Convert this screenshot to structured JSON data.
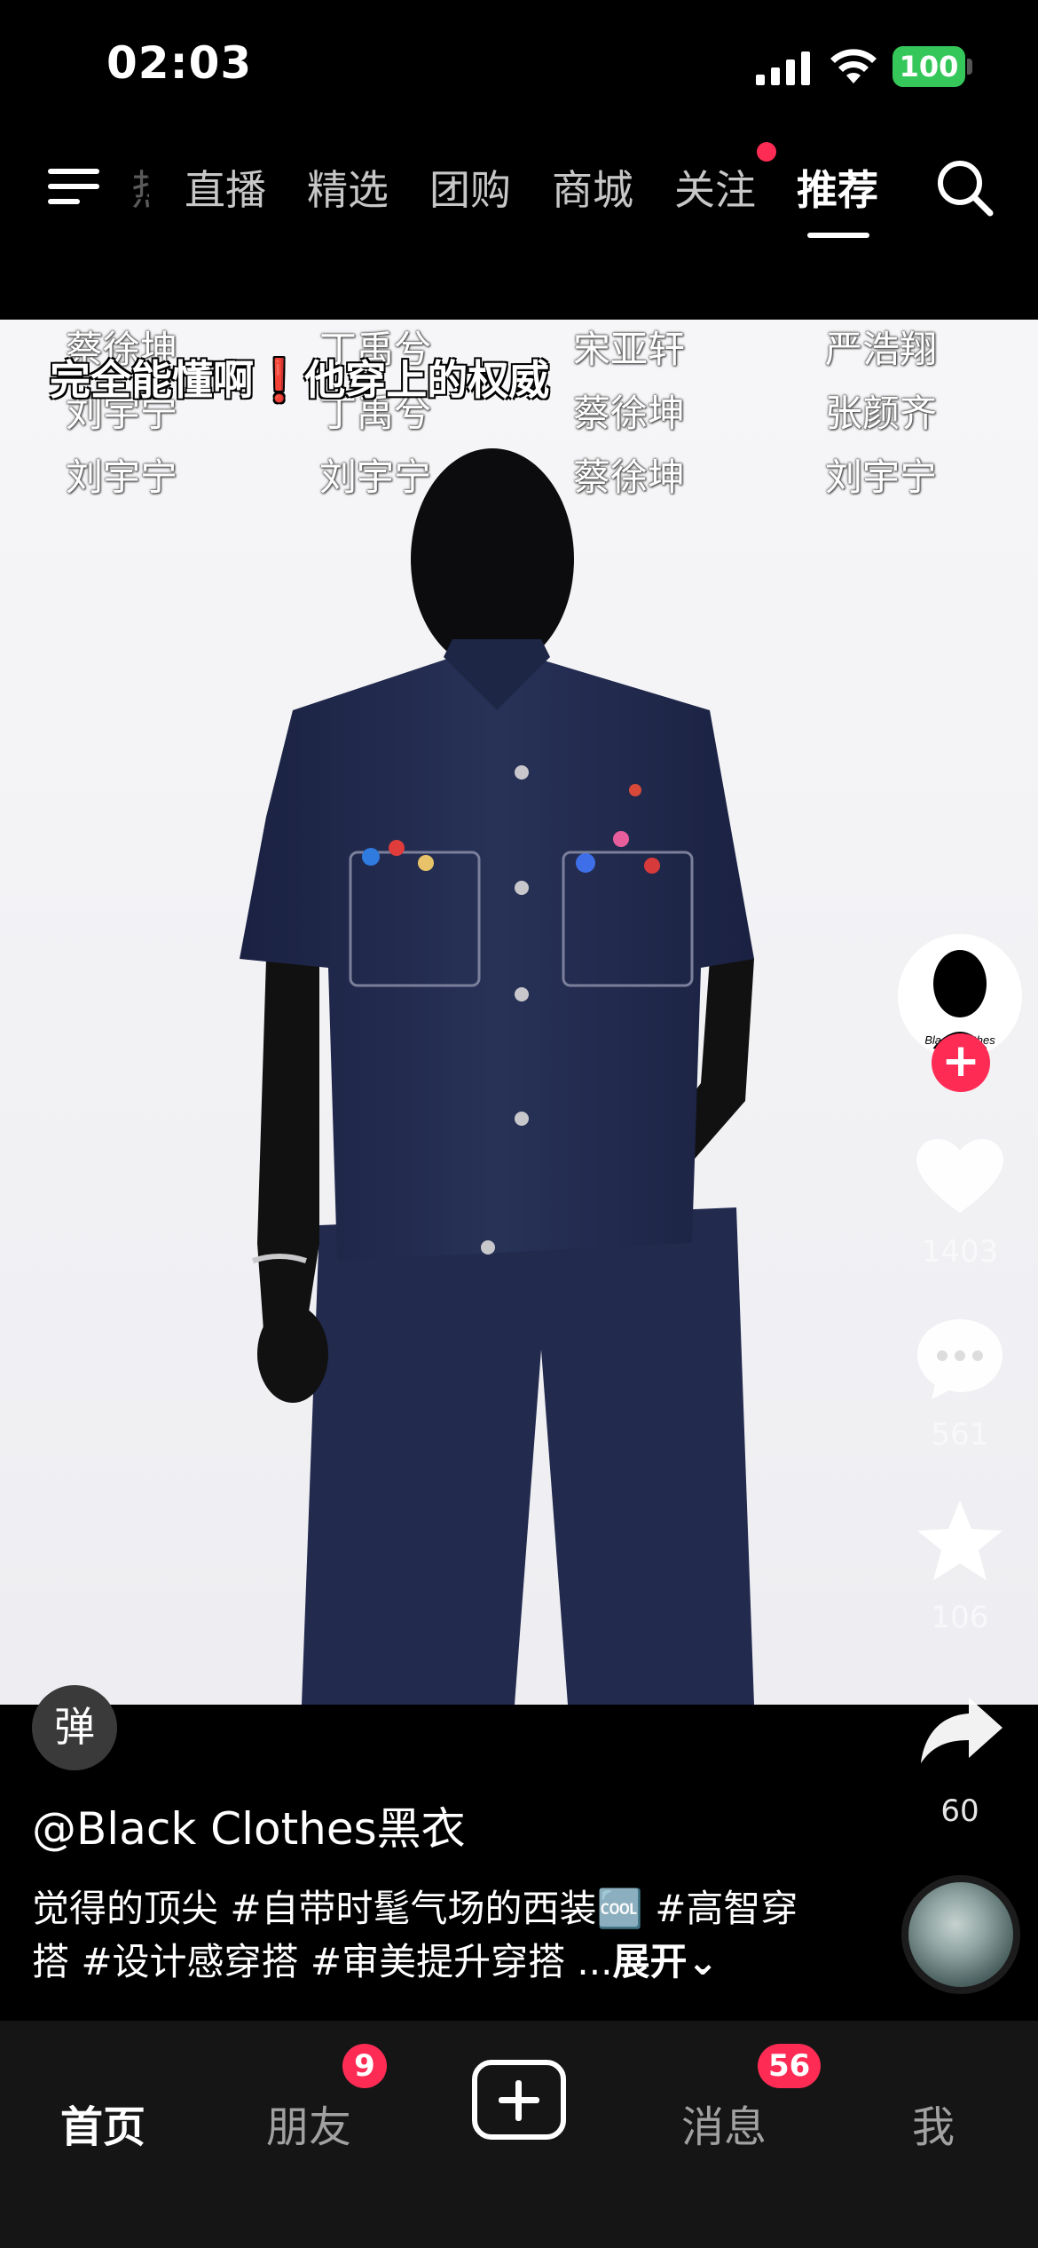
{
  "status_bar": {
    "time": "02:03",
    "battery": "100"
  },
  "top_nav": {
    "faint_tab": "热",
    "tabs": [
      "直播",
      "精选",
      "团购",
      "商城",
      "关注",
      "推荐"
    ],
    "active_tab": "推荐"
  },
  "video": {
    "danmaku_rows": [
      [
        "蔡徐坤",
        "丁禹兮",
        "宋亚轩",
        "严浩翔"
      ],
      [
        "刘宇宁",
        "丁禹兮",
        "蔡徐坤",
        "张颜齐"
      ],
      [
        "刘宇宁",
        "刘宇宁",
        "蔡徐坤",
        "刘宇宁"
      ]
    ],
    "caption_part1": "完全能懂啊",
    "caption_excl": "❗",
    "caption_part2": "他穿上的权威"
  },
  "right_rail": {
    "avatar_text": "Black Clothes",
    "likes": "1403",
    "comments": "561",
    "favorites": "106",
    "shares": "60"
  },
  "danmu_button": "弹",
  "post": {
    "username": "@Black Clothes黑衣",
    "description": "觉得的顶尖 #自带时髦气场的西装🆒 #高智穿搭 #设计感穿搭 #审美提升穿搭 ...",
    "expand_label": "展开⌄"
  },
  "tab_bar": {
    "home": "首页",
    "friends": "朋友",
    "friends_badge": "9",
    "messages": "消息",
    "messages_badge": "56",
    "me": "我"
  },
  "colors": {
    "accent": "#fe2c55",
    "battery": "#35c759",
    "denim": "#1f2748"
  }
}
